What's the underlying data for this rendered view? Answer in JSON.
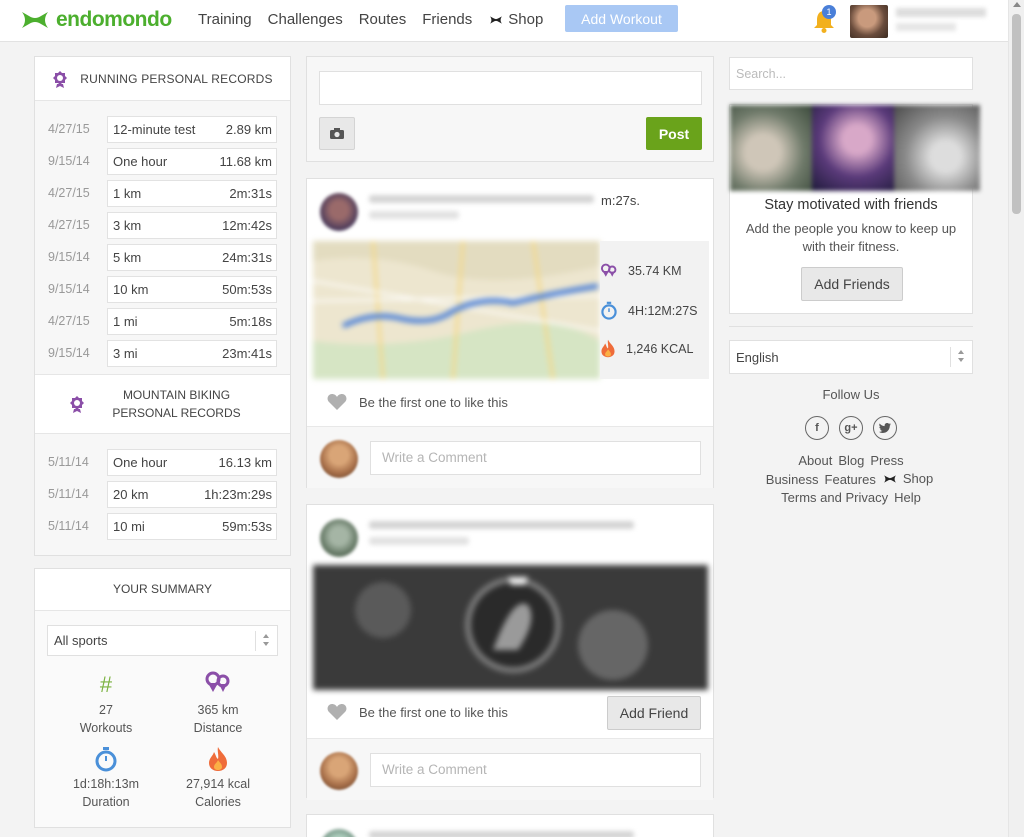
{
  "nav": {
    "brand": "endomondo",
    "links": [
      "Training",
      "Challenges",
      "Routes",
      "Friends"
    ],
    "shop_label": "Shop",
    "add_workout_label": "Add Workout",
    "notification_count": "1"
  },
  "running_records": {
    "title": "RUNNING PERSONAL RECORDS",
    "rows": [
      {
        "date": "4/27/15",
        "label": "12-minute test",
        "value": "2.89 km"
      },
      {
        "date": "9/15/14",
        "label": "One hour",
        "value": "11.68 km"
      },
      {
        "date": "4/27/15",
        "label": "1 km",
        "value": "2m:31s"
      },
      {
        "date": "4/27/15",
        "label": "3 km",
        "value": "12m:42s"
      },
      {
        "date": "9/15/14",
        "label": "5 km",
        "value": "24m:31s"
      },
      {
        "date": "9/15/14",
        "label": "10 km",
        "value": "50m:53s"
      },
      {
        "date": "4/27/15",
        "label": "1 mi",
        "value": "5m:18s"
      },
      {
        "date": "9/15/14",
        "label": "3 mi",
        "value": "23m:41s"
      }
    ]
  },
  "biking_records": {
    "title": "MOUNTAIN BIKING PERSONAL RECORDS",
    "rows": [
      {
        "date": "5/11/14",
        "label": "One hour",
        "value": "16.13 km"
      },
      {
        "date": "5/11/14",
        "label": "20 km",
        "value": "1h:23m:29s"
      },
      {
        "date": "5/11/14",
        "label": "10 mi",
        "value": "59m:53s"
      }
    ]
  },
  "summary": {
    "title": "YOUR SUMMARY",
    "sport_select": "All sports",
    "stats": [
      {
        "value": "27",
        "label": "Workouts"
      },
      {
        "value": "365 km",
        "label": "Distance"
      },
      {
        "value": "1d:18h:13m",
        "label": "Duration"
      },
      {
        "value": "27,914 kcal",
        "label": "Calories"
      }
    ]
  },
  "composer": {
    "post_label": "Post"
  },
  "feed": [
    {
      "title_suffix": "m:27s.",
      "distance": "35.74 KM",
      "duration": "4H:12M:27S",
      "calories": "1,246 KCAL",
      "like_text": "Be the first one to like this",
      "comment_placeholder": "Write a Comment"
    },
    {
      "like_text": "Be the first one to like this",
      "add_friend_label": "Add Friend",
      "comment_placeholder": "Write a Comment"
    }
  ],
  "sidebar": {
    "search_placeholder": "Search...",
    "motivation_title": "Stay motivated with friends",
    "motivation_text": "Add the people you know to keep up with their fitness.",
    "add_friends_label": "Add Friends",
    "language": "English",
    "follow_label": "Follow Us",
    "footer_links": [
      "About",
      "Blog",
      "Press",
      "Business",
      "Features",
      "Shop",
      "Terms and Privacy",
      "Help"
    ]
  },
  "colors": {
    "brand_green": "#4caf2e",
    "post_green": "#6aa31b",
    "add_workout_blue": "#a9c8f4",
    "purple": "#8b4fa8"
  }
}
